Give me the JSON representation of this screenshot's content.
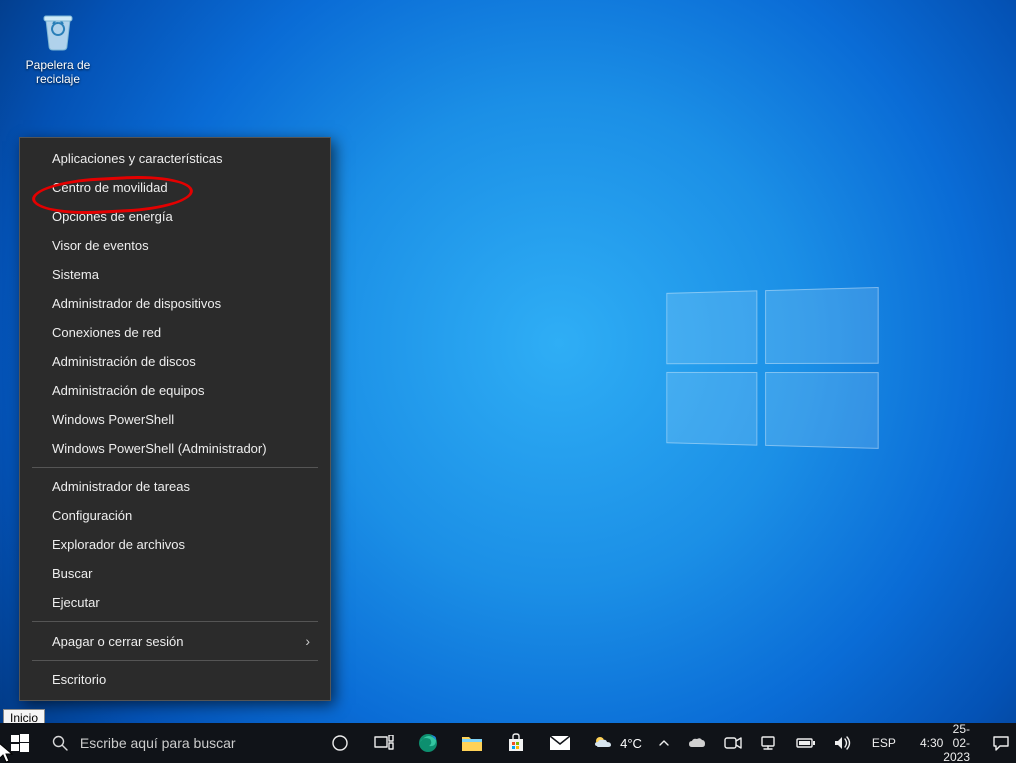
{
  "desktop": {
    "recycle_bin_label": "Papelera de\nreciclaje"
  },
  "context_menu": {
    "items": [
      {
        "label": "Aplicaciones y características",
        "type": "item"
      },
      {
        "label": "Centro de movilidad",
        "type": "item",
        "highlighted": true
      },
      {
        "label": "Opciones de energía",
        "type": "item"
      },
      {
        "label": "Visor de eventos",
        "type": "item"
      },
      {
        "label": "Sistema",
        "type": "item"
      },
      {
        "label": "Administrador de dispositivos",
        "type": "item"
      },
      {
        "label": "Conexiones de red",
        "type": "item"
      },
      {
        "label": "Administración de discos",
        "type": "item"
      },
      {
        "label": "Administración de equipos",
        "type": "item"
      },
      {
        "label": "Windows PowerShell",
        "type": "item"
      },
      {
        "label": "Windows PowerShell (Administrador)",
        "type": "item"
      },
      {
        "type": "sep"
      },
      {
        "label": "Administrador de tareas",
        "type": "item"
      },
      {
        "label": "Configuración",
        "type": "item"
      },
      {
        "label": "Explorador de archivos",
        "type": "item"
      },
      {
        "label": "Buscar",
        "type": "item"
      },
      {
        "label": "Ejecutar",
        "type": "item"
      },
      {
        "type": "sep"
      },
      {
        "label": "Apagar o cerrar sesión",
        "type": "item",
        "submenu": true
      },
      {
        "type": "sep"
      },
      {
        "label": "Escritorio",
        "type": "item"
      }
    ]
  },
  "tooltip": {
    "start": "Inicio"
  },
  "taskbar": {
    "search_placeholder": "Escribe aquí para buscar",
    "weather_temp": "4°C",
    "language": "ESP",
    "clock_time": "4:30",
    "clock_date": "25-02-2023"
  }
}
